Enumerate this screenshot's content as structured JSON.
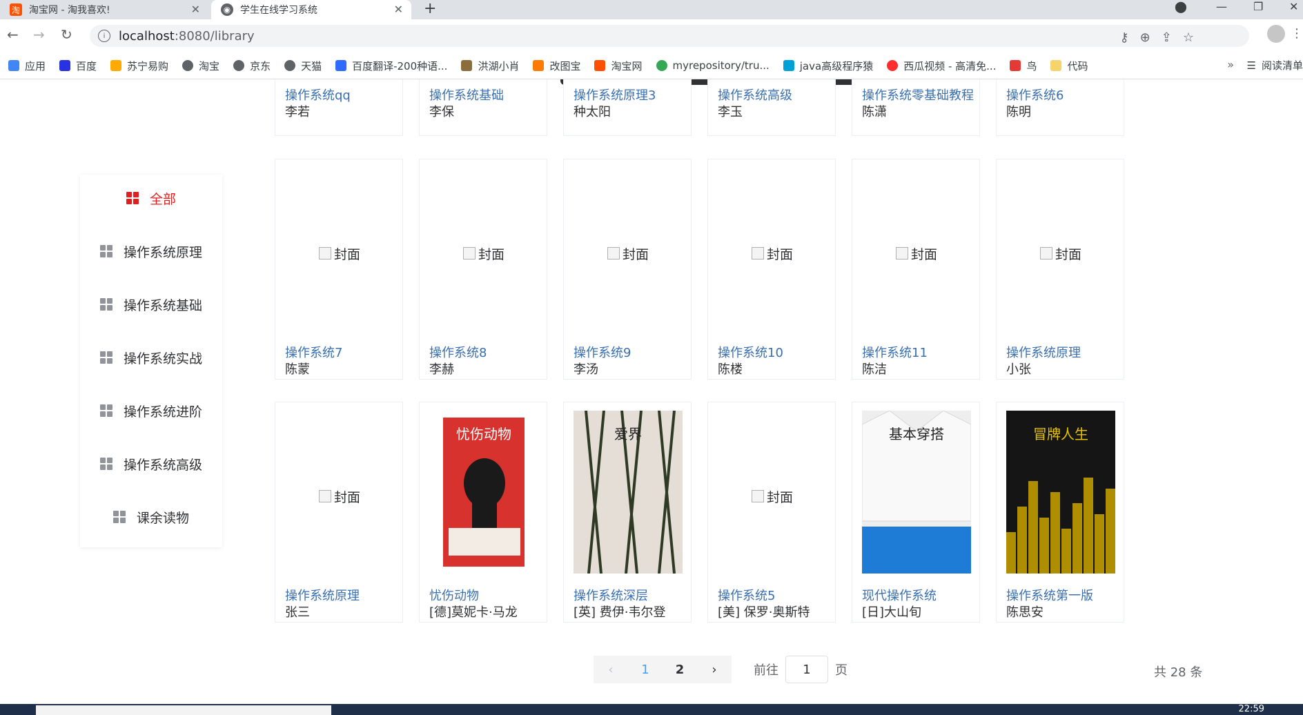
{
  "browser": {
    "tabs": [
      {
        "title": "淘宝网 - 淘我喜欢!",
        "favicon": "taobao-icon",
        "active": false
      },
      {
        "title": "学生在线学习系统",
        "favicon": "globe-icon",
        "active": true
      }
    ],
    "url_host": "localhost",
    "url_rest": ":8080/library",
    "bookmarks": [
      {
        "label": "应用",
        "icon": "apps-icon",
        "color": "#4285f4"
      },
      {
        "label": "百度",
        "icon": "baidu-icon",
        "color": "#2932e1"
      },
      {
        "label": "苏宁易购",
        "icon": "suning-icon",
        "color": "#ffaa00"
      },
      {
        "label": "淘宝",
        "icon": "globe-icon",
        "color": "#5f6368"
      },
      {
        "label": "京东",
        "icon": "globe-icon",
        "color": "#5f6368"
      },
      {
        "label": "天猫",
        "icon": "globe-icon",
        "color": "#5f6368"
      },
      {
        "label": "百度翻译-200种语...",
        "icon": "translate-icon",
        "color": "#2f6bff"
      },
      {
        "label": "洪湖小肖",
        "icon": "user-icon",
        "color": "#8a6d3b"
      },
      {
        "label": "改图宝",
        "icon": "gaitubao-icon",
        "color": "#ff7a00"
      },
      {
        "label": "淘宝网",
        "icon": "taobao-icon",
        "color": "#ff5000"
      },
      {
        "label": "myrepository/tru...",
        "icon": "chrome-icon",
        "color": "#34a853"
      },
      {
        "label": "java高级程序猿",
        "icon": "bilibili-icon",
        "color": "#00a1d6"
      },
      {
        "label": "西瓜视频 - 高清免...",
        "icon": "xigua-icon",
        "color": "#ff2d2d"
      },
      {
        "label": "鸟",
        "icon": "bird-icon",
        "color": "#e53935"
      },
      {
        "label": "代码",
        "icon": "code-icon",
        "color": "#f6d36b"
      }
    ],
    "reading_list": "阅读清单"
  },
  "sidebar": {
    "items": [
      {
        "label": "全部",
        "active": true
      },
      {
        "label": "操作系统原理",
        "active": false
      },
      {
        "label": "操作系统基础",
        "active": false
      },
      {
        "label": "操作系统实战",
        "active": false
      },
      {
        "label": "操作系统进阶",
        "active": false
      },
      {
        "label": "操作系统高级",
        "active": false
      },
      {
        "label": "课余读物",
        "active": false
      }
    ]
  },
  "cover_alt": "封面",
  "books_row0": [
    {
      "title": "操作系统qq",
      "author": "李若"
    },
    {
      "title": "操作系统基础",
      "author": "李保"
    },
    {
      "title": "操作系统原理3",
      "author": "种太阳"
    },
    {
      "title": "操作系统高级",
      "author": "李玉"
    },
    {
      "title": "操作系统零基础教程",
      "author": "陈潇"
    },
    {
      "title": "操作系统6",
      "author": "陈明"
    }
  ],
  "books_row1": [
    {
      "title": "操作系统7",
      "author": "陈蒙",
      "cover": "broken"
    },
    {
      "title": "操作系统8",
      "author": "李赫",
      "cover": "broken"
    },
    {
      "title": "操作系统9",
      "author": "李汤",
      "cover": "broken"
    },
    {
      "title": "操作系统10",
      "author": "陈楼",
      "cover": "broken"
    },
    {
      "title": "操作系统11",
      "author": "陈洁",
      "cover": "broken"
    },
    {
      "title": "操作系统原理",
      "author": "小张",
      "cover": "broken"
    }
  ],
  "books_row2": [
    {
      "title": "操作系统原理",
      "author": "张三",
      "cover": "broken"
    },
    {
      "title": "忧伤动物",
      "author": "[德]莫妮卡·马龙",
      "cover": "red",
      "cover_text": "忧伤动物"
    },
    {
      "title": "操作系统深层",
      "author": "[英] 费伊·韦尔登",
      "cover": "thorns",
      "cover_text": "爱界"
    },
    {
      "title": "操作系统5",
      "author": "[美] 保罗·奥斯特",
      "cover": "broken"
    },
    {
      "title": "现代操作系统",
      "author": "[日]大山旬",
      "cover": "shirt",
      "cover_text": "基本穿搭"
    },
    {
      "title": "操作系统第一版",
      "author": "陈思安",
      "cover": "city",
      "cover_text": "冒牌人生"
    }
  ],
  "pagination": {
    "pages": [
      "1",
      "2"
    ],
    "current": "1",
    "goto_prefix": "前往",
    "goto_value": "1",
    "goto_suffix": "页",
    "total": "共 28 条"
  },
  "taskbar": {
    "clock": "22:59"
  }
}
